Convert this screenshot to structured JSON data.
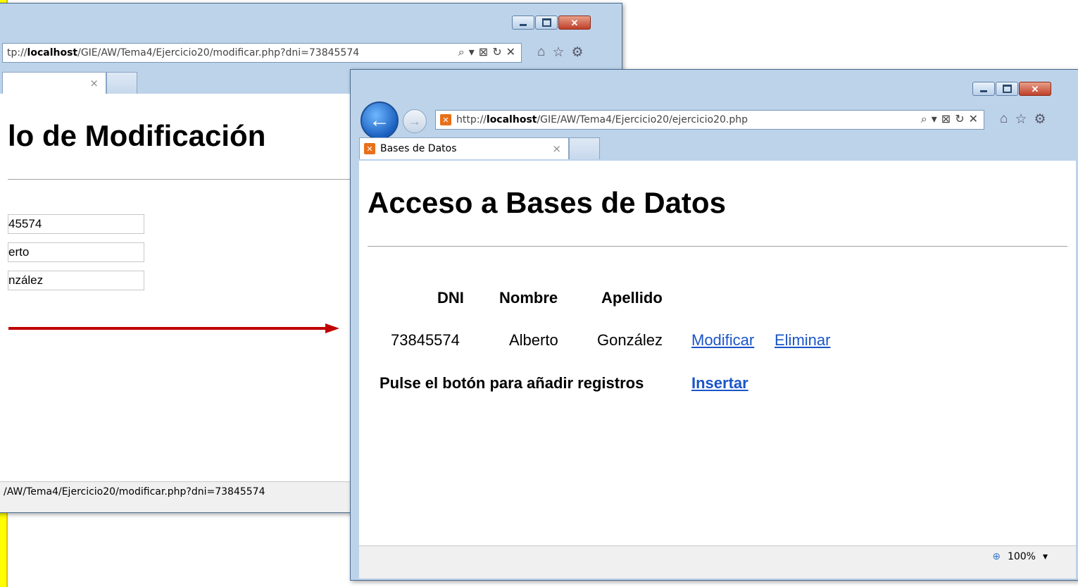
{
  "back_window": {
    "url_prefix": "tp://",
    "url_host": "localhost",
    "url_path": "/GIE/AW/Tema4/Ejercicio20/modificar.php?dni=73845574",
    "tab_close": "×",
    "heading": "lo de Modificación",
    "fields": [
      "45574",
      "erto",
      "nzález"
    ],
    "status_url": "/AW/Tema4/Ejercicio20/modificar.php?dni=73845574"
  },
  "front_window": {
    "url_prefix": "http://",
    "url_host": "localhost",
    "url_path": "/GIE/AW/Tema4/Ejercicio20/ejercicio20.php",
    "tab_title": "Bases de Datos",
    "tab_close": "×",
    "heading": "Acceso a Bases de Datos",
    "table": {
      "headers": [
        "DNI",
        "Nombre",
        "Apellido"
      ],
      "row": {
        "dni": "73845574",
        "nombre": "Alberto",
        "apellido": "González"
      },
      "modify_link": "Modificar",
      "delete_link": "Eliminar"
    },
    "insert_prompt": "Pulse el botón para añadir registros",
    "insert_link": "Insertar",
    "zoom": "100%"
  },
  "icons": {
    "search": "⌕",
    "dropdown": "▾",
    "compat": "⊠",
    "refresh": "↻",
    "stop": "✕",
    "home": "⌂",
    "star": "☆",
    "gear": "⚙",
    "back": "←",
    "forward": "→",
    "zoom": "⊕"
  },
  "colors": {
    "link": "#1a55c8",
    "arrow": "#c00000",
    "highlight": "#ffff00"
  }
}
